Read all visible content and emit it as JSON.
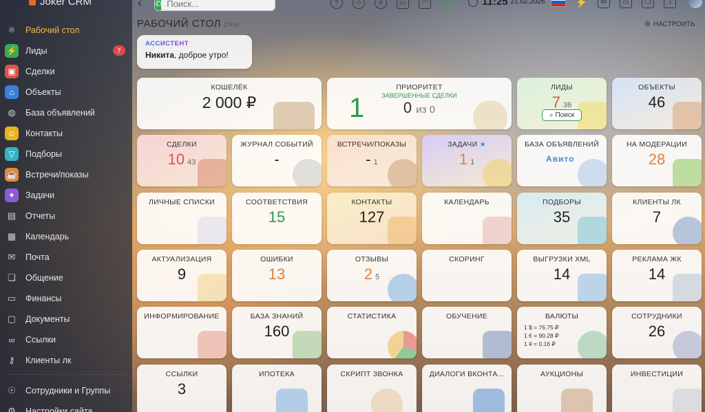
{
  "app": {
    "name": "Joker CRM"
  },
  "sidebar": {
    "items": [
      {
        "label": "Рабочий стол",
        "icon": "atom-icon",
        "color": ""
      },
      {
        "label": "Лиды",
        "icon": "lightning-icon",
        "color": "#3daa55",
        "badge": "7"
      },
      {
        "label": "Сделки",
        "icon": "briefcase-icon",
        "color": "#e05347"
      },
      {
        "label": "Объекты",
        "icon": "house-icon",
        "color": "#3b7fd9"
      },
      {
        "label": "База объявлений",
        "icon": "globe-icon",
        "color": ""
      },
      {
        "label": "Контакты",
        "icon": "contact-card-icon",
        "color": "#e6b422"
      },
      {
        "label": "Подборы",
        "icon": "funnel-icon",
        "color": "#35b3c4"
      },
      {
        "label": "Встречи/показы",
        "icon": "coffee-cup-icon",
        "color": "#e8873a"
      },
      {
        "label": "Задачи",
        "icon": "lightbulb-icon",
        "color": "#8a5cd6"
      },
      {
        "label": "Отчеты",
        "icon": "clipboard-icon",
        "color": ""
      },
      {
        "label": "Календарь",
        "icon": "calendar-icon",
        "color": ""
      },
      {
        "label": "Почта",
        "icon": "mail-icon",
        "color": ""
      },
      {
        "label": "Общение",
        "icon": "chat-icon",
        "color": ""
      },
      {
        "label": "Финансы",
        "icon": "wallet-icon",
        "color": ""
      },
      {
        "label": "Документы",
        "icon": "folder-icon",
        "color": ""
      },
      {
        "label": "Ссылки",
        "icon": "link-icon",
        "color": ""
      },
      {
        "label": "Клиенты лк",
        "icon": "key-icon",
        "color": ""
      }
    ],
    "bottom": [
      {
        "label": "Сотрудники и Группы",
        "icon": "people-icon"
      },
      {
        "label": "Настройки сайта",
        "icon": "settings-icon"
      }
    ]
  },
  "topbar": {
    "search_placeholder": "Поиск...",
    "time": "11:25",
    "date": "21.02.2026"
  },
  "page": {
    "title": "РАБОЧИЙ СТОЛ",
    "title_suffix": "CRM",
    "configure_label": "НАСТРОИТЬ"
  },
  "assistant": {
    "label": "АССИСТЕНТ",
    "name": "Никита",
    "message": ", доброе утро!"
  },
  "tiles": {
    "wallet": {
      "title": "КОШЕЛЁК",
      "value": "2 000 ₽"
    },
    "priority": {
      "title": "ПРИОРИТЕТ",
      "big": "1",
      "subtitle": "ЗАВЕРШЕННЫЕ СДЕЛКИ",
      "value": "0",
      "of": "из 0"
    },
    "leads": {
      "title": "ЛИДЫ",
      "value": "7",
      "sub": "36",
      "search_label": "Поиск"
    },
    "objects": {
      "title": "ОБЪЕКТЫ",
      "value": "46"
    },
    "deals": {
      "title": "СДЕЛКИ",
      "value": "10",
      "sub": "43"
    },
    "events": {
      "title": "ЖУРНАЛ СОБЫТИЙ",
      "value": "-"
    },
    "meetings": {
      "title": "ВСТРЕЧИ/ПОКАЗЫ",
      "value": "-",
      "sub": "1"
    },
    "tasks": {
      "title": "ЗАДАЧИ",
      "value": "1",
      "sub": "1"
    },
    "ads_base": {
      "title": "БАЗА ОБЪЯВЛЕНИЙ",
      "logo": "Авито"
    },
    "moderation": {
      "title": "НА МОДЕРАЦИИ",
      "value": "28"
    },
    "personal_lists": {
      "title": "ЛИЧНЫЕ СПИСКИ"
    },
    "matches": {
      "title": "СООТВЕТСТВИЯ",
      "value": "15"
    },
    "contacts": {
      "title": "КОНТАКТЫ",
      "value": "127"
    },
    "calendar": {
      "title": "КАЛЕНДАРЬ"
    },
    "selections": {
      "title": "ПОДБОРЫ",
      "value": "35"
    },
    "clients_lk": {
      "title": "КЛИЕНТЫ ЛК",
      "value": "7"
    },
    "actualization": {
      "title": "АКТУАЛИЗАЦИЯ",
      "value": "9"
    },
    "errors": {
      "title": "ОШИБКИ",
      "value": "13"
    },
    "reviews": {
      "title": "ОТЗЫВЫ",
      "value": "2",
      "sub": "5"
    },
    "scoring": {
      "title": "СКОРИНГ"
    },
    "xml": {
      "title": "ВЫГРУЗКИ XML",
      "value": "14"
    },
    "ads_jk": {
      "title": "РЕКЛАМА ЖК",
      "value": "14"
    },
    "informing": {
      "title": "ИНФОРМИРОВАНИЕ"
    },
    "knowledge": {
      "title": "БАЗА ЗНАНИЙ",
      "value": "160"
    },
    "statistics": {
      "title": "СТАТИСТИКА"
    },
    "training": {
      "title": "ОБУЧЕНИЕ"
    },
    "currencies": {
      "title": "ВАЛЮТЫ",
      "rates": [
        "1 $ = 76.75 ₽",
        "1 € = 90.28 ₽",
        "1 ¥ = 0.16 ₽"
      ]
    },
    "employees": {
      "title": "СОТРУДНИКИ",
      "value": "26"
    },
    "links": {
      "title": "ССЫЛКИ",
      "value": "3"
    },
    "mortgage": {
      "title": "ИПОТЕКА"
    },
    "call_script": {
      "title": "СКРИПТ ЗВОНКА"
    },
    "vk_dialogs": {
      "title": "ДИАЛОГИ ВКОНТА..."
    },
    "auctions": {
      "title": "АУКЦИОНЫ"
    },
    "investments": {
      "title": "ИНВЕСТИЦИИ"
    }
  },
  "colors": {
    "accent_green": "#2e9b4b",
    "accent_orange": "#e0803a",
    "accent_red": "#d9534f",
    "active_nav": "#f0b84a"
  }
}
